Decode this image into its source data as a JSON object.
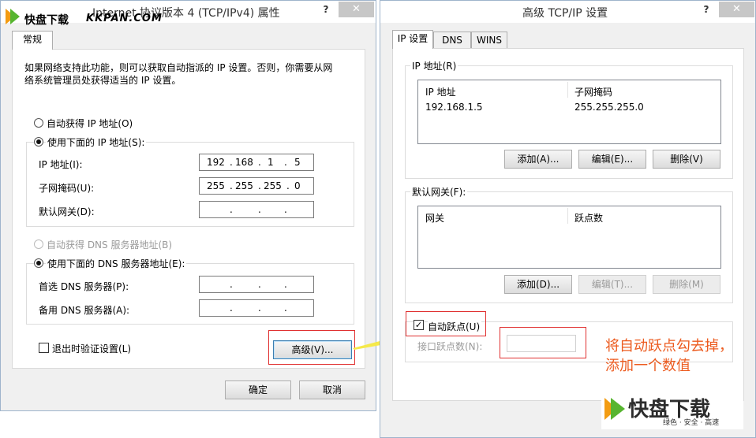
{
  "watermark": {
    "cn": "快盘下载",
    "en": "KKPAN.COM"
  },
  "left_dialog": {
    "title": "Internet 协议版本 4 (TCP/IPv4) 属性",
    "help": "?",
    "close": "✕",
    "tab": "常规",
    "description_line1": "如果网络支持此功能，则可以获取自动指派的 IP 设置。否则，你需要从网",
    "description_line2": "络系统管理员处获得适当的 IP 设置。",
    "auto_ip_label": "自动获得 IP 地址(O)",
    "use_ip_label": "使用下面的 IP 地址(S):",
    "ip_label": "IP 地址(I):",
    "ip_value": [
      "192",
      "168",
      "1",
      "5"
    ],
    "mask_label": "子网掩码(U):",
    "mask_value": [
      "255",
      "255",
      "255",
      "0"
    ],
    "gateway_label": "默认网关(D):",
    "auto_dns_label": "自动获得 DNS 服务器地址(B)",
    "use_dns_label": "使用下面的 DNS 服务器地址(E):",
    "pref_dns_label": "首选 DNS 服务器(P):",
    "alt_dns_label": "备用 DNS 服务器(A):",
    "validate_label": "退出时验证设置(L)",
    "advanced_button": "高级(V)...",
    "ok_button": "确定",
    "cancel_button": "取消"
  },
  "right_dialog": {
    "title": "高级 TCP/IP 设置",
    "help": "?",
    "close": "✕",
    "tabs": [
      "IP 设置",
      "DNS",
      "WINS"
    ],
    "ip_group_label": "IP 地址(R)",
    "ip_table": {
      "headers": [
        "IP 地址",
        "子网掩码"
      ],
      "rows": [
        [
          "192.168.1.5",
          "255.255.255.0"
        ]
      ]
    },
    "ip_buttons": [
      "添加(A)...",
      "编辑(E)...",
      "删除(V)"
    ],
    "gw_group_label": "默认网关(F):",
    "gw_table": {
      "headers": [
        "网关",
        "跃点数"
      ]
    },
    "gw_buttons": [
      "添加(D)...",
      "编辑(T)...",
      "删除(M)"
    ],
    "auto_metric_label": "自动跃点(U)",
    "interface_metric_label": "接口跃点数(N):",
    "interface_metric_value": ""
  },
  "annotation": {
    "line1": "将自动跃点勾去掉，",
    "line2": "添加一个数值"
  },
  "logo": {
    "text": "快盘下载",
    "slogan": "绿色 · 安全 · 高速"
  },
  "colors": {
    "note": "#ec5b1f",
    "highlight_box": "#e03030",
    "arrow": "#f5e94a",
    "logo_green": "#57b530"
  }
}
